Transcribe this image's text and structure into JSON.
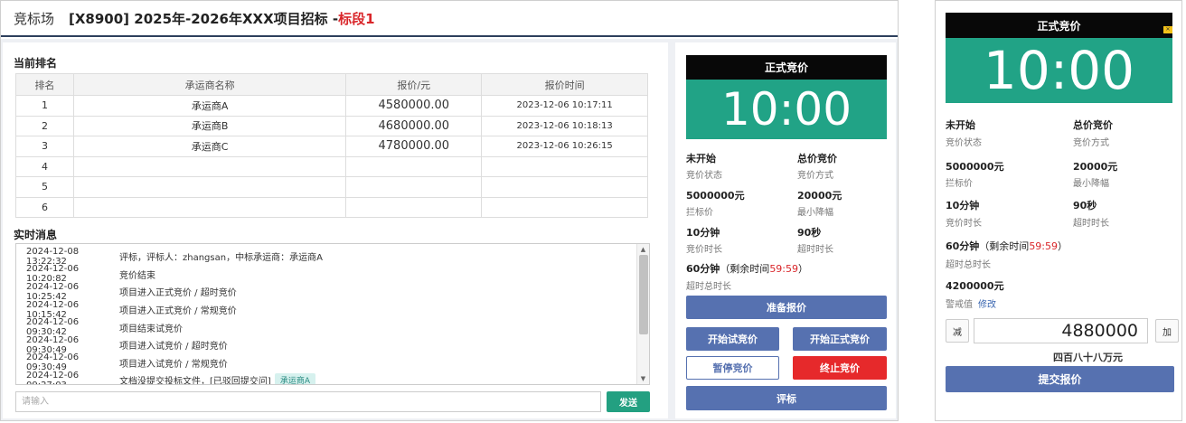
{
  "header": {
    "app_name": "竞标场",
    "project_title": "[X8900] 2025年-2026年XXX项目招标 - ",
    "lot": "标段1"
  },
  "ranking": {
    "title": "当前排名",
    "columns": [
      "排名",
      "承运商名称",
      "报价/元",
      "报价时间"
    ],
    "rows": [
      [
        "1",
        "承运商A",
        "4580000.00",
        "2023-12-06 10:17:11"
      ],
      [
        "2",
        "承运商B",
        "4680000.00",
        "2023-12-06 10:18:13"
      ],
      [
        "3",
        "承运商C",
        "4780000.00",
        "2023-12-06 10:26:15"
      ],
      [
        "4",
        "",
        "",
        ""
      ],
      [
        "5",
        "",
        "",
        ""
      ],
      [
        "6",
        "",
        "",
        ""
      ]
    ]
  },
  "messages": {
    "title": "实时消息",
    "items": [
      {
        "time": "2024-12-08 13:22:32",
        "text": "评标，评标人：zhangsan，中标承运商：承运商A"
      },
      {
        "time": "2024-12-06 10:20:82",
        "text": "竞价结束"
      },
      {
        "time": "2024-12-06 10:25:42",
        "text": "项目进入正式竞价 / 超时竞价"
      },
      {
        "time": "2024-12-06 10:15:42",
        "text": "项目进入正式竞价 / 常规竞价"
      },
      {
        "time": "2024-12-06 09:30:42",
        "text": "项目结束试竞价"
      },
      {
        "time": "2024-12-06 09:30:49",
        "text": "项目进入试竞价 / 超时竞价"
      },
      {
        "time": "2024-12-06 09:30:49",
        "text": "项目进入试竞价 / 常规竞价"
      },
      {
        "time": "2024-12-06 09:27:03",
        "text": "文档没提交投标文件，[已驳回提交问]",
        "tag": "承运商A"
      }
    ],
    "input_placeholder": "请输入",
    "send_label": "发送"
  },
  "panel": {
    "header": "正式竞价",
    "timer": "10:00",
    "status_value": "未开始",
    "status_label": "竞价状态",
    "mode_value": "总价竞价",
    "mode_label": "竞价方式",
    "ceiling_value": "5000000元",
    "ceiling_label": "拦标价",
    "min_step_value": "20000元",
    "min_step_label": "最小降幅",
    "duration_value": "10分钟",
    "duration_label": "竞价时长",
    "overtime_value": "90秒",
    "overtime_label": "超时时长",
    "total_overtime_value": "60分钟",
    "remaining_prefix": "（剩余时间",
    "remaining_value": "59:59",
    "remaining_suffix": "）",
    "total_overtime_label": "超时总时长",
    "buttons": {
      "prepare": "准备报价",
      "start_trial": "开始试竞价",
      "start_formal": "开始正式竞价",
      "pause": "暂停竞价",
      "terminate": "终止竞价",
      "evaluate": "评标"
    }
  },
  "panel2": {
    "header": "正式竞价",
    "timer": "10:00",
    "corner_mark": "✕",
    "status_value": "未开始",
    "status_label": "竞价状态",
    "mode_value": "总价竞价",
    "mode_label": "竞价方式",
    "ceiling_value": "5000000元",
    "ceiling_label": "拦标价",
    "min_step_value": "20000元",
    "min_step_label": "最小降幅",
    "duration_value": "10分钟",
    "duration_label": "竞价时长",
    "overtime_value": "90秒",
    "overtime_label": "超时时长",
    "total_overtime_value": "60分钟",
    "remaining_prefix": "（剩余时间",
    "remaining_value": "59:59",
    "remaining_suffix": "）",
    "total_overtime_label": "超时总时长",
    "warning_value": "4200000元",
    "warning_label": "警戒值",
    "edit_link": "修改",
    "decrease_label": "减",
    "increase_label": "加",
    "bid_value": "4880000",
    "amount_words": "四百八十八万元",
    "submit_label": "提交报价"
  }
}
